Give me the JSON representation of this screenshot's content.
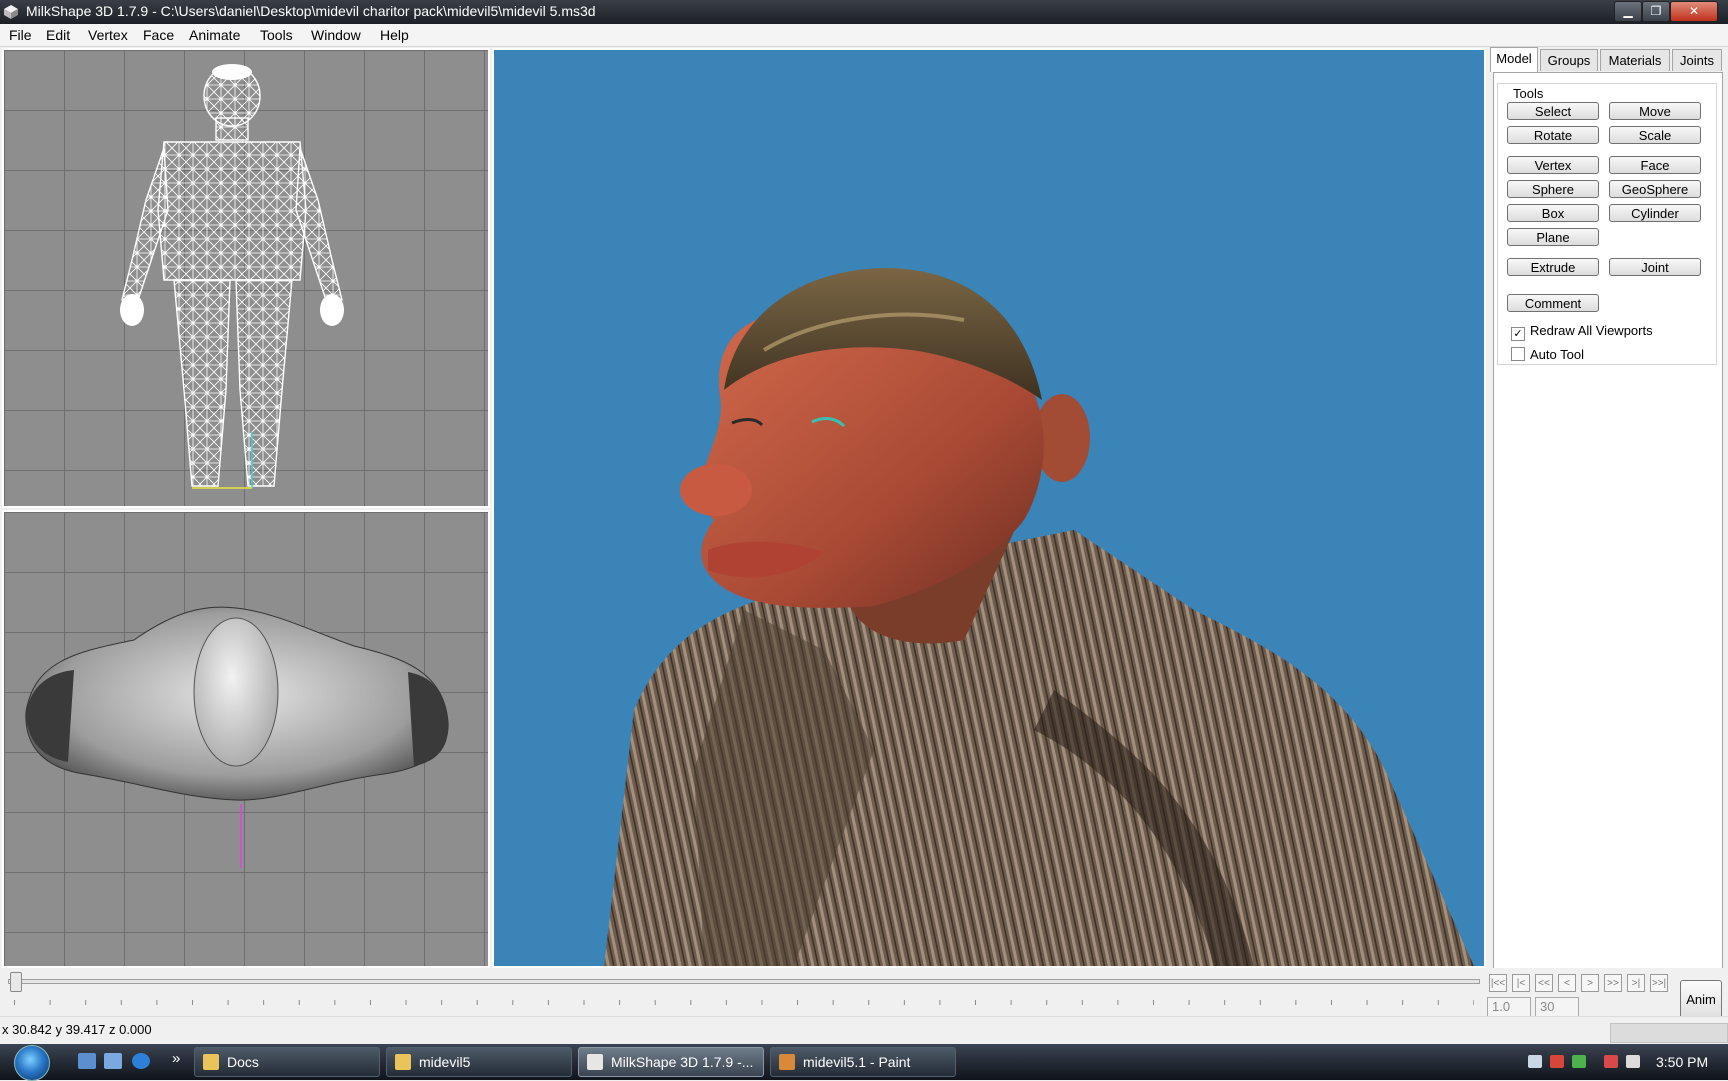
{
  "window": {
    "title": "MilkShape 3D 1.7.9 - C:\\Users\\daniel\\Desktop\\midevil charitor pack\\midevil5\\midevil 5.ms3d",
    "controls": [
      "minimize",
      "maximize",
      "close"
    ]
  },
  "menu": [
    "File",
    "Edit",
    "Vertex",
    "Face",
    "Animate",
    "Tools",
    "Window",
    "Help"
  ],
  "panel": {
    "tabs": [
      "Model",
      "Groups",
      "Materials",
      "Joints"
    ],
    "active_tab": "Model",
    "group_label": "Tools",
    "buttons": {
      "select": "Select",
      "move": "Move",
      "rotate": "Rotate",
      "scale": "Scale",
      "vertex": "Vertex",
      "face": "Face",
      "sphere": "Sphere",
      "geosphere": "GeoSphere",
      "box": "Box",
      "cylinder": "Cylinder",
      "plane": "Plane",
      "extrude": "Extrude",
      "joint": "Joint",
      "comment": "Comment"
    },
    "checkboxes": {
      "redraw_all": {
        "label": "Redraw All Viewports",
        "checked": true
      },
      "auto_tool": {
        "label": "Auto Tool",
        "checked": false
      }
    }
  },
  "timeline": {
    "frame_value": "1.0",
    "total_frames": "30",
    "anim_label": "Anim"
  },
  "status": {
    "coords": "x 30.842 y 39.417 z 0.000"
  },
  "taskbar": {
    "items": [
      "Docs",
      "midevil5",
      "MilkShape 3D 1.7.9 -...",
      "midevil5.1 - Paint"
    ],
    "active_index": 2,
    "clock": "3:50 PM",
    "overflow": "»"
  },
  "colors": {
    "viewport_3d_bg": "#3a84b8",
    "viewport_grid_bg": "#8e8e8e"
  }
}
